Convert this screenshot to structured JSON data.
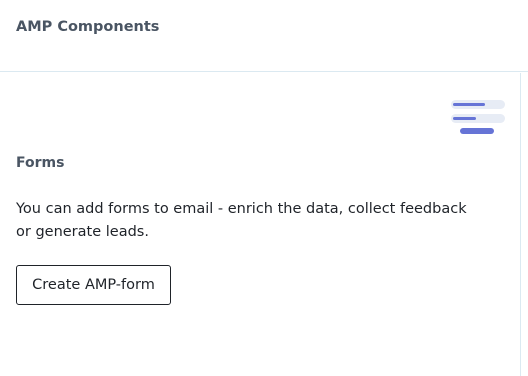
{
  "header": {
    "title": "AMP Components"
  },
  "card": {
    "illustration_icon": "form-lines-icon",
    "section_title": "Forms",
    "description": "You can add forms to email - enrich the data, collect feedback or generate leads.",
    "button_label": "Create AMP-form"
  },
  "colors": {
    "heading": "#4a5563",
    "text": "#1f2329",
    "divider": "#dbe9f1",
    "accent": "#6674d6",
    "accent_light": "#e7ecf5"
  }
}
